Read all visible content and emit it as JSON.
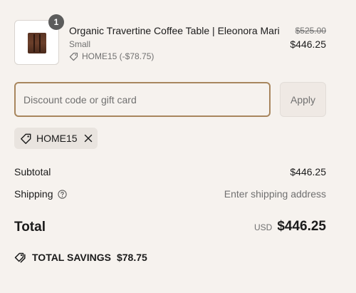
{
  "line_item": {
    "quantity": "1",
    "title": "Organic Travertine Coffee Table | Eleonora Mari",
    "variant": "Small",
    "discount_code": "HOME15 (-$78.75)",
    "compare_price": "$525.00",
    "price": "$446.25"
  },
  "discount": {
    "placeholder": "Discount code or gift card",
    "value": "",
    "apply_label": "Apply",
    "applied_code": "HOME15"
  },
  "summary": {
    "subtotal_label": "Subtotal",
    "subtotal_value": "$446.25",
    "shipping_label": "Shipping",
    "shipping_value": "Enter shipping address",
    "total_label": "Total",
    "currency": "USD",
    "total_value": "$446.25",
    "savings_label": "TOTAL SAVINGS",
    "savings_value": "$78.75"
  },
  "colors": {
    "background": "#f6f2ee",
    "input_focus_border": "#a8865e",
    "muted_text": "#707070"
  },
  "icons": {
    "tag": "tag-icon",
    "close": "close-icon",
    "help": "help-circle-icon",
    "savings": "savings-tag-icon"
  }
}
